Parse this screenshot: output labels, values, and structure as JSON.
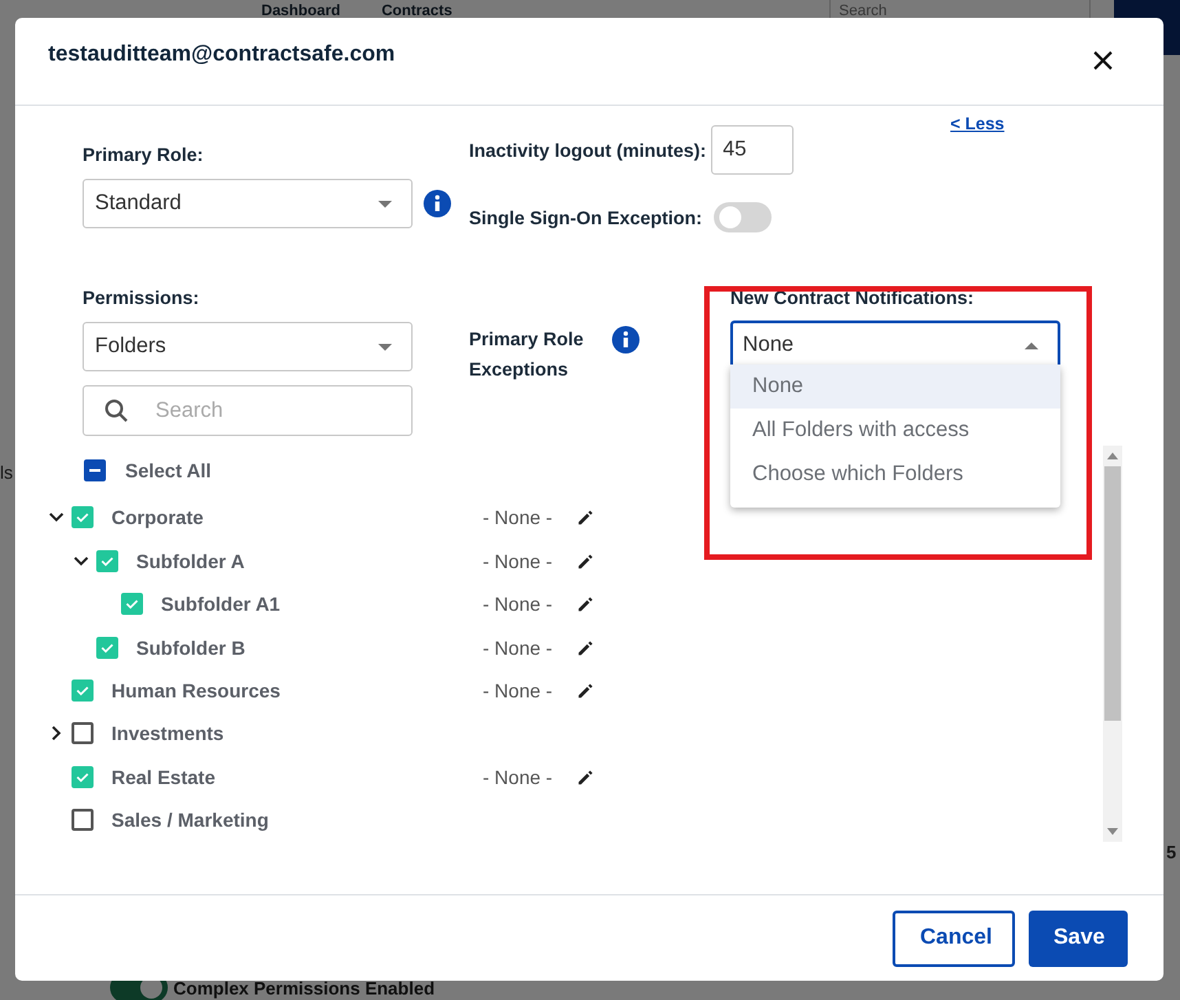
{
  "background_page": {
    "nav_items": [
      "Dashboard",
      "Contracts"
    ],
    "search": {
      "placeholder": "Search"
    },
    "side_text": "ls",
    "table_value": "5",
    "complex_permissions": {
      "label": "Complex Permissions Enabled",
      "on": true
    }
  },
  "dialog": {
    "title": "testauditteam@contractsafe.com",
    "primary_role": {
      "label": "Primary Role:",
      "value": "Standard"
    },
    "inactivity": {
      "label": "Inactivity logout (minutes):",
      "value": "45"
    },
    "less_link": "< Less",
    "sso_exception": {
      "label": "Single Sign-On Exception:",
      "on": false
    },
    "permissions": {
      "label": "Permissions:",
      "value": "Folders",
      "search": {
        "placeholder": "Search"
      }
    },
    "primary_role_exceptions": {
      "label": "Primary Role Exceptions"
    },
    "notifications": {
      "label": "New Contract Notifications:",
      "value": "None",
      "expanded": true,
      "highlighted": true,
      "options": [
        {
          "label": "None",
          "selected": true
        },
        {
          "label": "All Folders with access",
          "selected": false
        },
        {
          "label": "Choose which Folders",
          "selected": false
        }
      ]
    },
    "select_all": {
      "label": "Select All",
      "indeterminate": true
    },
    "folders": [
      {
        "label": "Corporate",
        "checked": true,
        "expanded": true,
        "note": "- None -",
        "children": [
          {
            "label": "Subfolder A",
            "checked": true,
            "expanded": true,
            "note": "- None -",
            "children": [
              {
                "label": "Subfolder A1",
                "checked": true,
                "note": "- None -"
              }
            ]
          },
          {
            "label": "Subfolder B",
            "checked": true,
            "note": "- None -"
          }
        ]
      },
      {
        "label": "Human Resources",
        "checked": true,
        "note": "- None -"
      },
      {
        "label": "Investments",
        "checked": false,
        "expanded": false
      },
      {
        "label": "Real Estate",
        "checked": true,
        "note": "- None -"
      },
      {
        "label": "Sales / Marketing",
        "checked": false
      }
    ],
    "buttons": [
      {
        "label": "Cancel",
        "kind": "secondary"
      },
      {
        "label": "Save",
        "kind": "primary"
      }
    ]
  }
}
